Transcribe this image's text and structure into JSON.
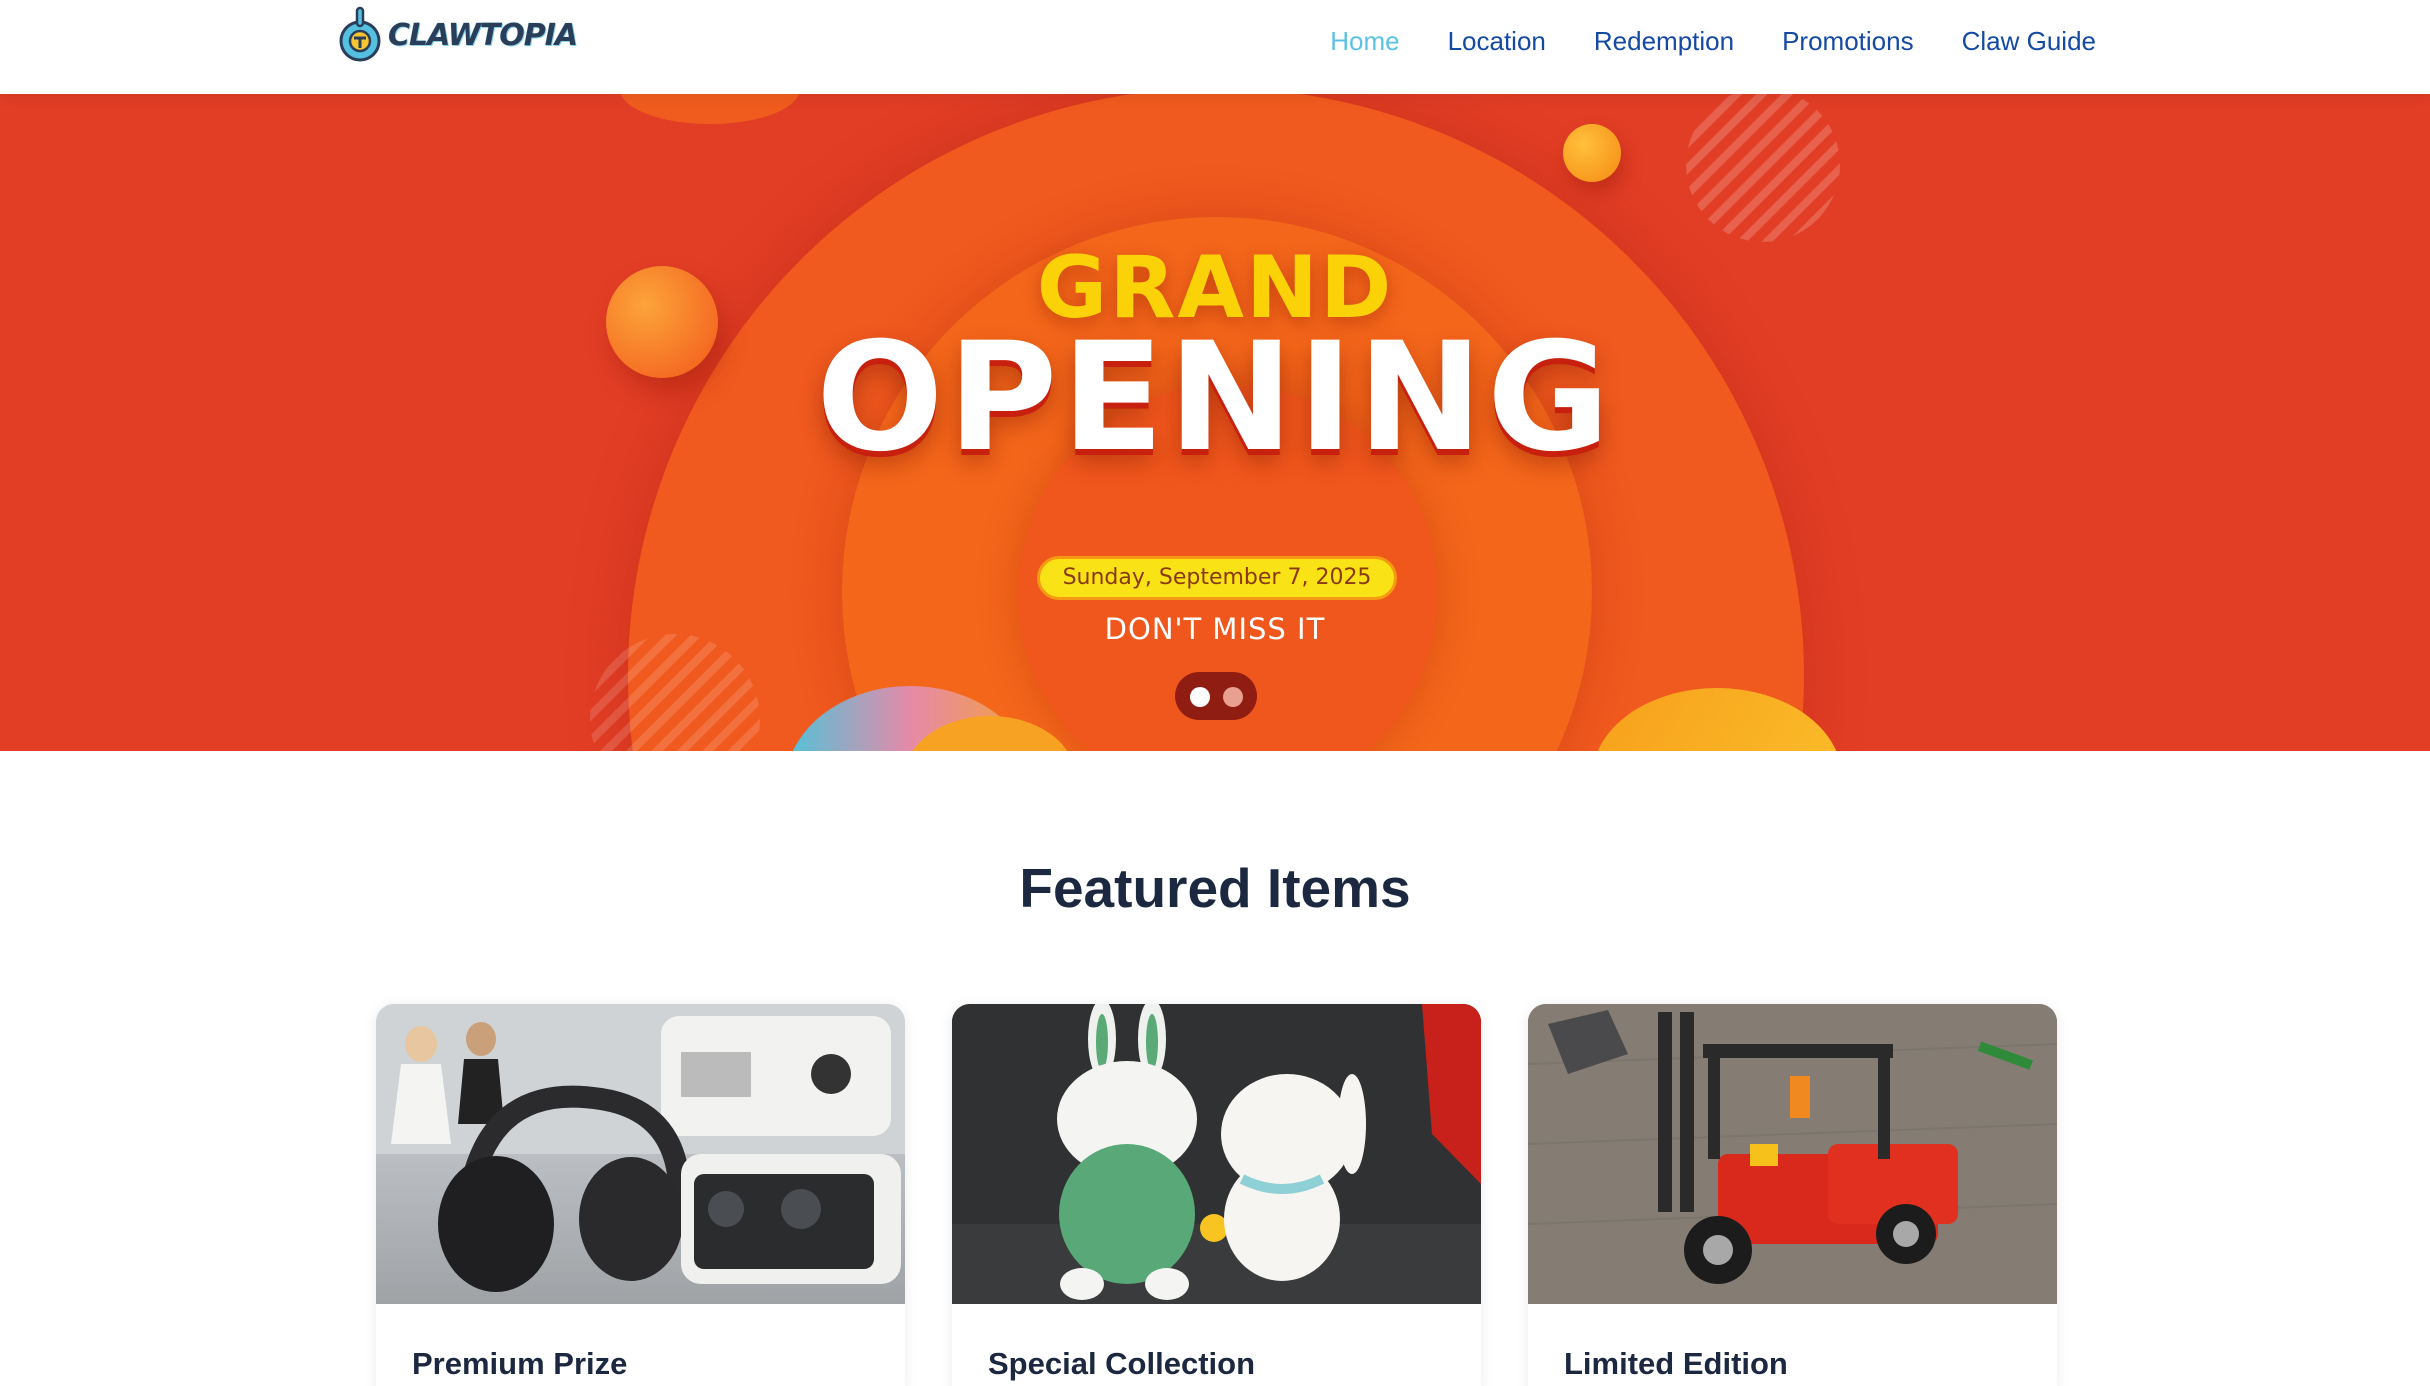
{
  "header": {
    "logo_text": "CLAWTOPIA",
    "nav": [
      {
        "label": "Home",
        "active": true
      },
      {
        "label": "Location",
        "active": false
      },
      {
        "label": "Redemption",
        "active": false
      },
      {
        "label": "Promotions",
        "active": false
      },
      {
        "label": "Claw Guide",
        "active": false
      }
    ]
  },
  "hero": {
    "title_line1": "GRAND",
    "title_line2": "OPENING",
    "date": "Sunday, September 7, 2025",
    "cta": "DON'T MISS IT",
    "carousel": {
      "slide_count": 2,
      "active_index": 0
    }
  },
  "featured": {
    "heading": "Featured Items",
    "cards": [
      {
        "title": "Premium Prize",
        "image_icon": "headphones-projector-image"
      },
      {
        "title": "Special Collection",
        "image_icon": "plush-bunnies-image"
      },
      {
        "title": "Limited Edition",
        "image_icon": "toy-forklift-image"
      }
    ]
  },
  "colors": {
    "hero_bg": "#e23e25",
    "hero_orange": "#f25a1a",
    "title_yellow": "#fbd208",
    "nav_blue": "#154aa3",
    "nav_active": "#5bc2e6",
    "heading_dark": "#1c2840"
  }
}
